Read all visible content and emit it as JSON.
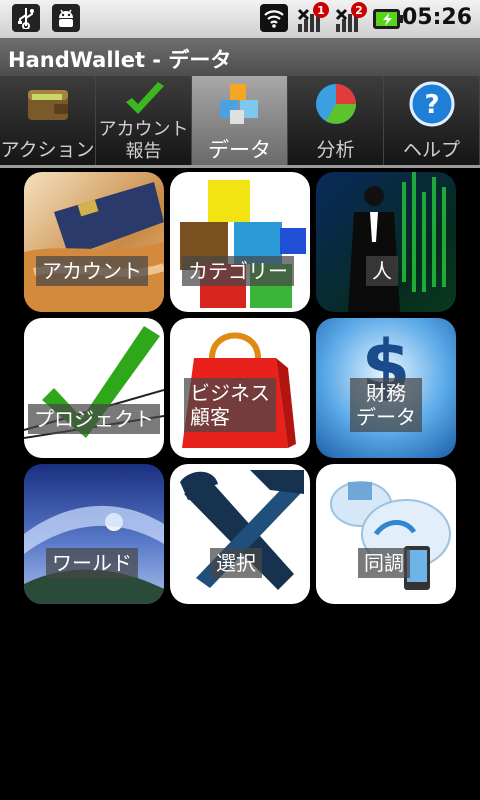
{
  "status": {
    "time": "05:26",
    "badge1": "1",
    "badge2": "2"
  },
  "app": {
    "title": "HandWallet - データ"
  },
  "tabs": [
    {
      "label": "アクション",
      "icon": "wallet-icon"
    },
    {
      "label_line1": "アカウント",
      "label_line2": "報告",
      "icon": "check-icon"
    },
    {
      "label": "データ",
      "icon": "cubes-icon",
      "active": true
    },
    {
      "label": "分析",
      "icon": "pie-chart-icon"
    },
    {
      "label": "ヘルプ",
      "icon": "help-icon"
    }
  ],
  "tiles": [
    {
      "label": "アカウント",
      "icon": "credit-card-icon"
    },
    {
      "label": "カテゴリー",
      "icon": "cubes-icon"
    },
    {
      "label": "人",
      "icon": "person-icon"
    },
    {
      "label": "プロジェクト",
      "icon": "checkmark-icon"
    },
    {
      "label_line1": "ビジネス",
      "label_line2": "顧客",
      "icon": "shopping-bag-icon"
    },
    {
      "label_line1": "財務",
      "label_line2": "データ",
      "icon": "dollar-icon"
    },
    {
      "label": "ワールド",
      "icon": "planet-icon"
    },
    {
      "label": "選択",
      "icon": "tools-icon"
    },
    {
      "label": "同調",
      "icon": "cloud-sync-icon"
    }
  ],
  "colors": {
    "background": "#000000",
    "status_bar": "#e0e0e0",
    "title_bar": "#5a5a5a",
    "active_tab": "#8f8f8f"
  }
}
